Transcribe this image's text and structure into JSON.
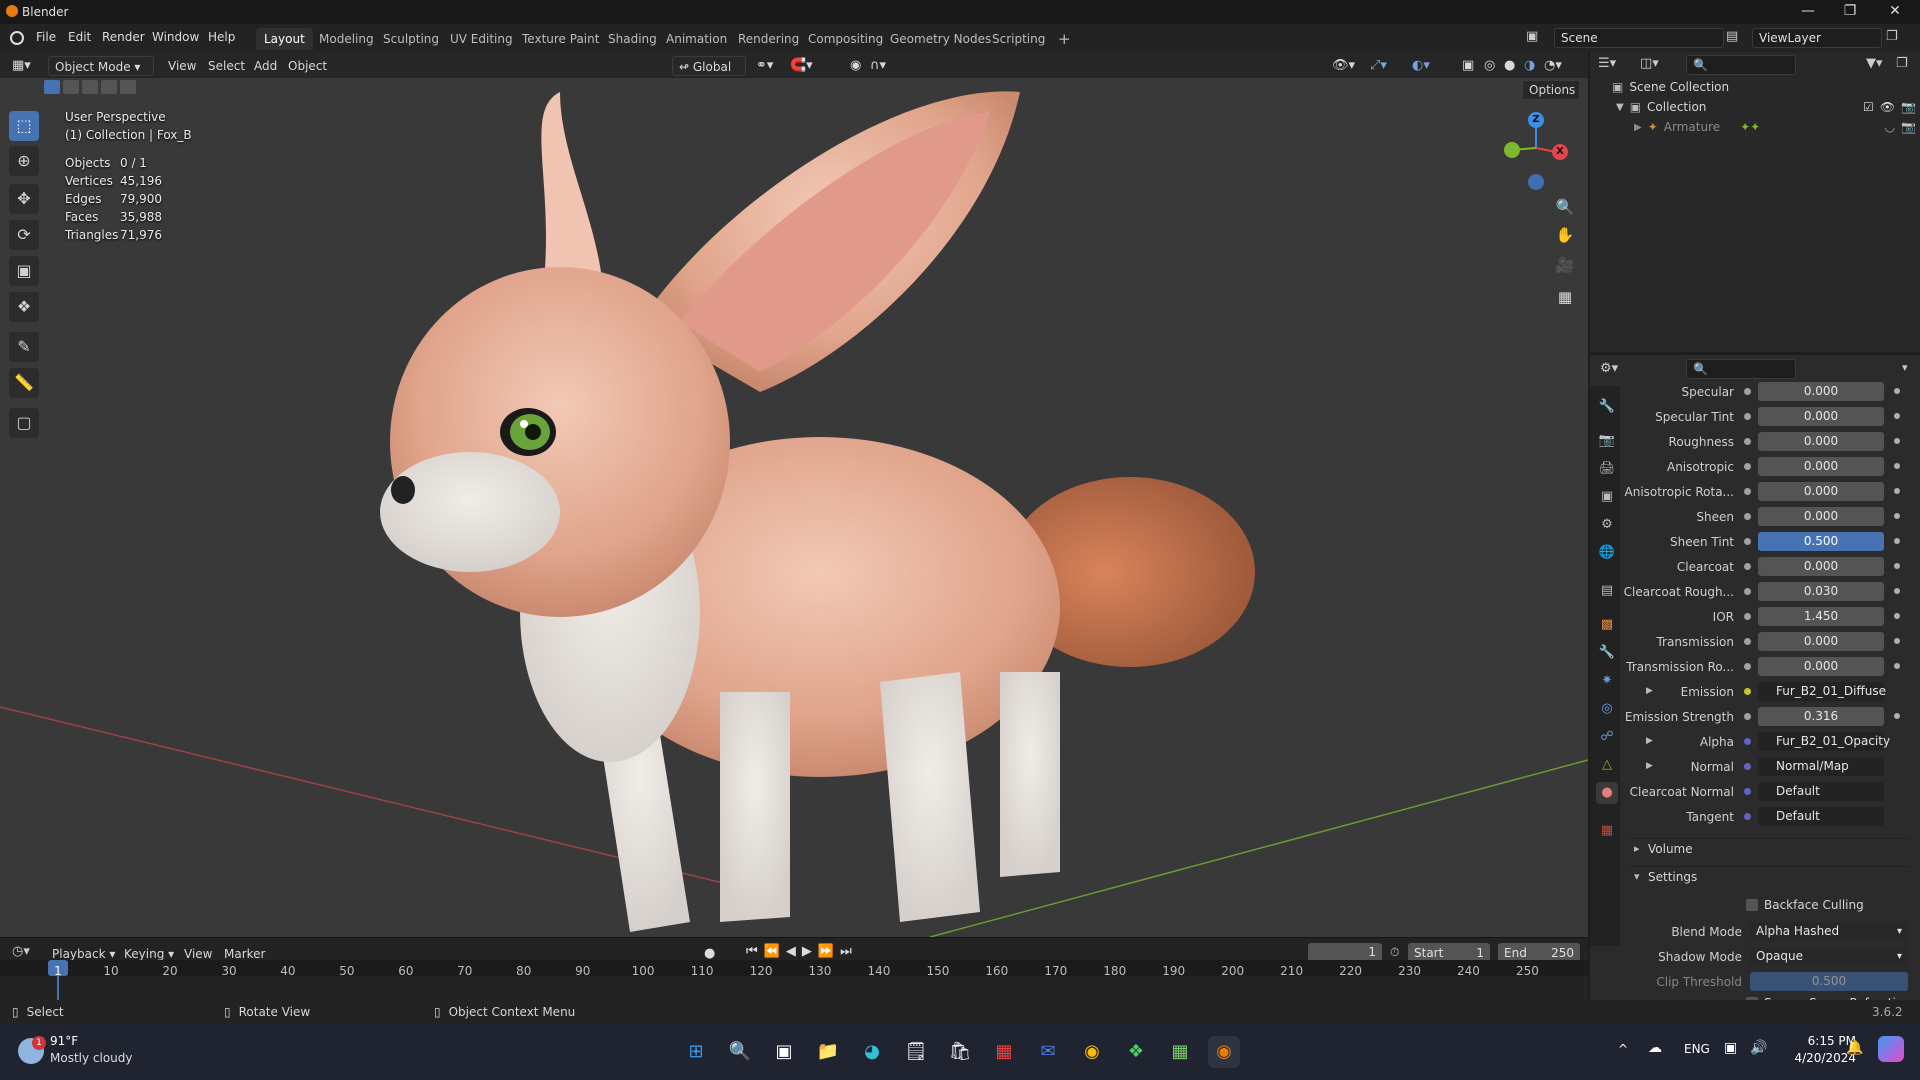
{
  "window": {
    "title": "Blender"
  },
  "menu": {
    "items": [
      "File",
      "Edit",
      "Render",
      "Window",
      "Help"
    ]
  },
  "workspaces": [
    "Layout",
    "Modeling",
    "Sculpting",
    "UV Editing",
    "Texture Paint",
    "Shading",
    "Animation",
    "Rendering",
    "Compositing",
    "Geometry Nodes",
    "Scripting"
  ],
  "scene": {
    "name": "Scene",
    "view_layer": "ViewLayer"
  },
  "viewport_header": {
    "mode": "Object Mode",
    "menus": [
      "View",
      "Select",
      "Add",
      "Object"
    ],
    "transform_orientation": "Global",
    "options": "Options"
  },
  "overlay": {
    "perspective": "User Perspective",
    "collection": "(1) Collection | Fox_B",
    "stats": [
      {
        "label": "Objects",
        "value": "0 / 1"
      },
      {
        "label": "Vertices",
        "value": "45,196"
      },
      {
        "label": "Edges",
        "value": "79,900"
      },
      {
        "label": "Faces",
        "value": "35,988"
      },
      {
        "label": "Triangles",
        "value": "71,976"
      }
    ]
  },
  "gizmo": {
    "z": "Z",
    "x": "X"
  },
  "outliner": {
    "root": "Scene Collection",
    "collection": "Collection",
    "child": "Armature"
  },
  "material_props": [
    {
      "label": "Specular",
      "value": "0.000",
      "type": "num"
    },
    {
      "label": "Specular Tint",
      "value": "0.000",
      "type": "num"
    },
    {
      "label": "Roughness",
      "value": "0.000",
      "type": "num"
    },
    {
      "label": "Anisotropic",
      "value": "0.000",
      "type": "num"
    },
    {
      "label": "Anisotropic Rota...",
      "value": "0.000",
      "type": "num"
    },
    {
      "label": "Sheen",
      "value": "0.000",
      "type": "num"
    },
    {
      "label": "Sheen Tint",
      "value": "0.500",
      "type": "hl"
    },
    {
      "label": "Clearcoat",
      "value": "0.000",
      "type": "num"
    },
    {
      "label": "Clearcoat Rough...",
      "value": "0.030",
      "type": "num"
    },
    {
      "label": "IOR",
      "value": "1.450",
      "type": "num"
    },
    {
      "label": "Transmission",
      "value": "0.000",
      "type": "num"
    },
    {
      "label": "Transmission Ro...",
      "value": "0.000",
      "type": "num"
    },
    {
      "label": "Emission",
      "value": "Fur_B2_01_Diffuse",
      "type": "link-yel"
    },
    {
      "label": "Emission Strength",
      "value": "0.316",
      "type": "num"
    },
    {
      "label": "Alpha",
      "value": "Fur_B2_01_Opacity",
      "type": "link-blu"
    },
    {
      "label": "Normal",
      "value": "Normal/Map",
      "type": "link-blu"
    },
    {
      "label": "Clearcoat Normal",
      "value": "Default",
      "type": "link-blu"
    },
    {
      "label": "Tangent",
      "value": "Default",
      "type": "link-blu"
    }
  ],
  "sections": {
    "volume": "Volume",
    "settings": "Settings"
  },
  "settings": {
    "backface_culling": "Backface Culling",
    "blend_mode_label": "Blend Mode",
    "blend_mode": "Alpha Hashed",
    "shadow_mode_label": "Shadow Mode",
    "shadow_mode": "Opaque",
    "clip_threshold_label": "Clip Threshold",
    "clip_threshold": "0.500",
    "ssr": "Screen Space Refraction"
  },
  "timeline": {
    "menus": [
      "Playback",
      "Keying",
      "View",
      "Marker"
    ],
    "current_frame": "1",
    "start_label": "Start",
    "start": "1",
    "end_label": "End",
    "end": "250",
    "ticks": [
      "1",
      "10",
      "20",
      "30",
      "40",
      "50",
      "60",
      "70",
      "80",
      "90",
      "100",
      "110",
      "120",
      "130",
      "140",
      "150",
      "160",
      "170",
      "180",
      "190",
      "200",
      "210",
      "220",
      "230",
      "240",
      "250"
    ]
  },
  "statusbar": {
    "select": "Select",
    "rotate": "Rotate View",
    "context": "Object Context Menu",
    "version": "3.6.2"
  },
  "taskbar": {
    "weather_temp": "91°F",
    "weather_desc": "Mostly cloudy",
    "weather_badge": "1",
    "lang": "ENG",
    "time": "6:15 PM",
    "date": "4/20/2024"
  },
  "colors": {
    "accent": "#4772b3",
    "blender_orange": "#e87d0d",
    "x_axis": "#e0484c",
    "y_axis": "#7cb72d",
    "z_axis": "#3f8ee5"
  }
}
